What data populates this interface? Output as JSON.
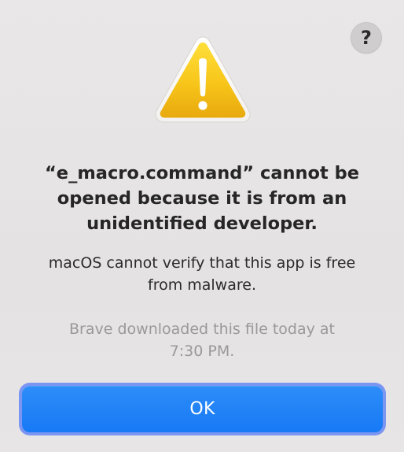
{
  "dialog": {
    "help_label": "?",
    "icon": "warning-triangle-icon",
    "title_lines": [
      "“e_macro.command” cannot be",
      "opened because it is from an",
      "unidentified developer."
    ],
    "message_lines": [
      "macOS cannot verify that this app is free",
      "from malware."
    ],
    "info_lines": [
      "Brave downloaded this file today at",
      "7:30 PM."
    ],
    "ok_label": "OK"
  },
  "colors": {
    "background": "#e6e4e4",
    "accent": "#1779f5",
    "focus_ring": "#7b95f2",
    "warning_yellow": "#f5c518",
    "secondary_text": "#9a9898"
  }
}
